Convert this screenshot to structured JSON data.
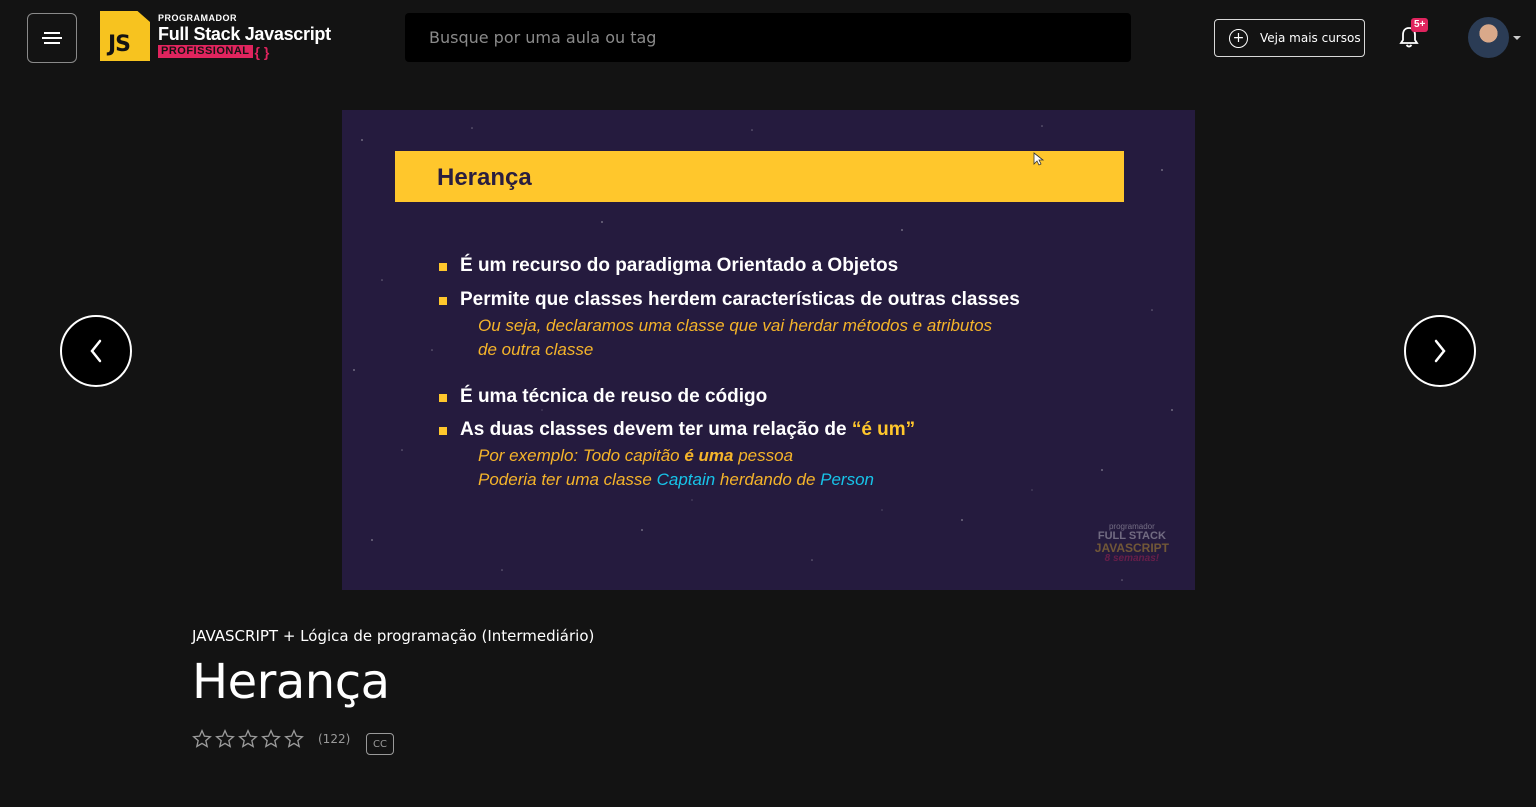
{
  "header": {
    "logo": {
      "small": "PROGRAMADOR",
      "main": "Full Stack Javascript",
      "sub": "PROFISSIONAL",
      "brace": "{ }",
      "badge": "JS"
    },
    "search": {
      "placeholder": "Busque por uma aula ou tag",
      "value": ""
    },
    "more_courses_label": "Veja mais cursos",
    "notifications_badge": "5+"
  },
  "video": {
    "slide_title": "Herança",
    "bullets": [
      {
        "text": "É um recurso do paradigma Orientado a Objetos"
      },
      {
        "text": "Permite que classes herdem características de outras classes",
        "sub": [
          "Ou seja, declaramos uma classe que vai herdar métodos e atributos",
          "de outra classe"
        ]
      },
      {
        "text": "É uma técnica de reuso de código"
      },
      {
        "text_before": "As duas classes devem ter uma relação de ",
        "text_highlight": "“é um”",
        "sub_example_before": "Por exemplo: Todo capitão ",
        "sub_example_bold": "é uma",
        "sub_example_after": " pessoa",
        "sub_class_before": "Poderia ter uma classe ",
        "sub_class_a": "Captain",
        "sub_class_mid": " herdando de ",
        "sub_class_b": "Person"
      }
    ],
    "watermark": [
      "programador",
      "FULL STACK",
      "JAVASCRIPT",
      "8 semanas!"
    ]
  },
  "lesson": {
    "course": "JAVASCRIPT + Lógica de programação (Intermediário)",
    "title": "Herança",
    "rating_count": "(122)",
    "cc_label": "CC"
  },
  "colors": {
    "accent_yellow": "#ffc72c",
    "accent_pink": "#e0245e",
    "slide_bg": "#251b3e",
    "highlight_cyan": "#17c3e8"
  }
}
